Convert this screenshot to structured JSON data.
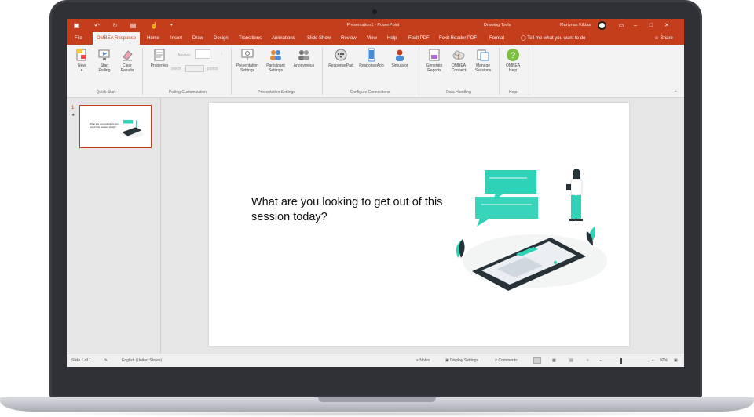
{
  "window": {
    "title": "Presentation1 - PowerPoint",
    "contextual_tools": "Drawing Tools",
    "user_name": "Martynas Kildas"
  },
  "tabs": [
    {
      "label": "File"
    },
    {
      "label": "OMBEA Response",
      "active": true
    },
    {
      "label": "Home"
    },
    {
      "label": "Insert"
    },
    {
      "label": "Draw"
    },
    {
      "label": "Design"
    },
    {
      "label": "Transitions"
    },
    {
      "label": "Animations"
    },
    {
      "label": "Slide Show"
    },
    {
      "label": "Review"
    },
    {
      "label": "View"
    },
    {
      "label": "Help"
    },
    {
      "label": "Foxit PDF"
    },
    {
      "label": "Foxit Reader PDF"
    },
    {
      "label": "Format"
    }
  ],
  "tell_me": "Tell me what you want to do",
  "share": "Share",
  "ribbon": {
    "quick_start": {
      "label": "Quick Start",
      "new": "New",
      "start_polling_1": "Start",
      "start_polling_2": "Polling",
      "clear_results_1": "Clear",
      "clear_results_2": "Results"
    },
    "polling_customization": {
      "label": "Polling Customization",
      "properties": "Properties",
      "answer": "Answer",
      "worth": "worth",
      "points": "points"
    },
    "presentation_settings": {
      "label": "Presentation Settings",
      "presentation_1": "Presentation",
      "presentation_2": "Settings",
      "participant_1": "Participant",
      "participant_2": "Settings",
      "anonymous": "Anonymous"
    },
    "configure_connections": {
      "label": "Configure Connections",
      "responsepad": "ResponsePad",
      "responseapp": "ResponseApp",
      "simulator": "Simulator"
    },
    "data_handling": {
      "label": "Data Handling",
      "generate_1": "Generate",
      "generate_2": "Reports",
      "connect_1": "OMBEA",
      "connect_2": "Connect",
      "manage_1": "Manage",
      "manage_2": "Sessions"
    },
    "help": {
      "label": "Help",
      "ombea_help_1": "OMBEA",
      "ombea_help_2": "Help"
    }
  },
  "thumbnails": [
    {
      "number": "1",
      "text": "What are you looking to get out of this session today?"
    }
  ],
  "slide": {
    "text": "What are you looking to get out of this session today?"
  },
  "statusbar": {
    "slide_counter": "Slide 1 of 1",
    "language": "English (United States)",
    "notes": "Notes",
    "display_settings": "Display Settings",
    "comments": "Comments",
    "zoom": "92%"
  },
  "colors": {
    "accent": "#c43e1c",
    "illustration_teal": "#2ed3b7",
    "illustration_dark": "#263238"
  }
}
